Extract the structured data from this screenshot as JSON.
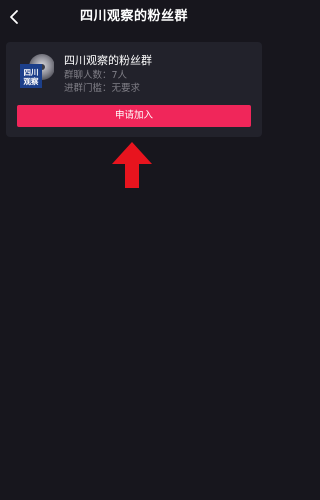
{
  "header": {
    "title": "四川观察的粉丝群",
    "back_icon": "chevron-left-icon"
  },
  "group_card": {
    "avatar_text_line1": "四川",
    "avatar_text_line2": "观察",
    "name": "四川观察的粉丝群",
    "members_label": "群聊人数：",
    "members_value": "7人",
    "threshold_label": "进群门槛：",
    "threshold_value": "无要求",
    "join_button_label": "申请加入"
  },
  "annotation": {
    "icon": "arrow-up-icon",
    "color": "#e8141e"
  },
  "colors": {
    "background": "#17161d",
    "card": "#22222b",
    "accent": "#f0265a",
    "secondary_text": "#7f7e86"
  }
}
